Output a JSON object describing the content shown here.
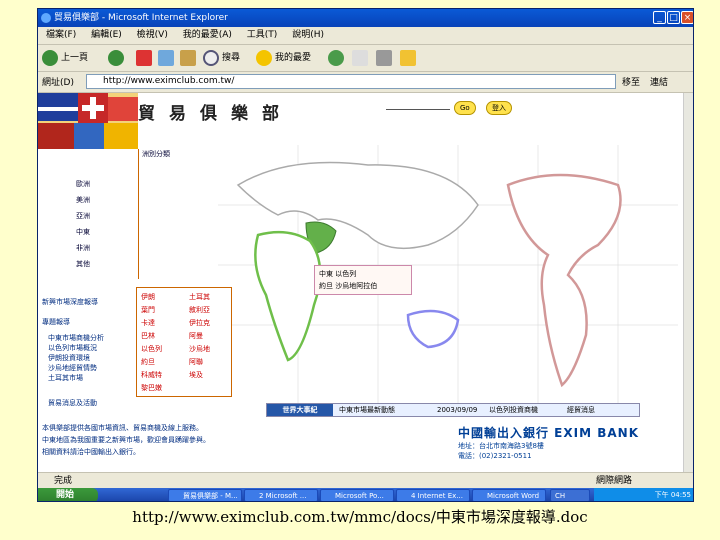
{
  "window": {
    "title": "貿易俱樂部 - Microsoft Internet Explorer"
  },
  "menu": [
    "檔案(F)",
    "編輯(E)",
    "檢視(V)",
    "我的最愛(A)",
    "工具(T)",
    "說明(H)"
  ],
  "toolbar": {
    "back_label": "上一頁",
    "search_label": "搜尋",
    "favorites_label": "我的最愛"
  },
  "address": {
    "label": "網址(D)",
    "value": "http://www.eximclub.com.tw/",
    "go_label": "移至",
    "links_label": "連結"
  },
  "site": {
    "title": "貿易俱樂部",
    "go_button": "Go",
    "login_button": "登入"
  },
  "categories": {
    "header": "洲別分類",
    "items": [
      "歐洲",
      "美洲",
      "亞洲",
      "中東",
      "非洲",
      "其他"
    ]
  },
  "country_list": {
    "col1": [
      "伊朗",
      "葉門",
      "卡達",
      "巴林",
      "以色列",
      "約旦",
      "科威特",
      "黎巴嫩"
    ],
    "col2": [
      "土耳其",
      "敘利亞",
      "伊拉克",
      "阿曼",
      "沙烏地",
      "阿聯",
      "埃及"
    ]
  },
  "left_section": {
    "heading": "新興市場深度報導",
    "subheading": "專題報導",
    "items": [
      "中東市場商機分析",
      "以色列市場概況",
      "伊朗投資環境",
      "沙烏地經貿情勢",
      "土耳其市場"
    ],
    "bottom_link": "貿易消息及活動"
  },
  "popup": {
    "line1": "中東 以色列",
    "line2": "約旦 沙烏地阿拉伯"
  },
  "news_bar": {
    "tag": "世界大事紀",
    "items": [
      "中東市場最新動態",
      "2003/09/09",
      "以色列投資商機",
      "經貿消息"
    ]
  },
  "bottom_text": [
    "本俱樂部提供各國市場資訊、貿易商機及線上服務。",
    "中東地區為我國重要之新興市場，歡迎會員踴躍參與。",
    "相關資料請洽中國輸出入銀行。"
  ],
  "bank": {
    "name": "中國輸出入銀行 EXIM BANK",
    "address": "地址：台北市南海路3號8樓",
    "phone": "電話：(02)2321-0511"
  },
  "status": {
    "left": "完成",
    "right": "網際網路"
  },
  "taskbar": {
    "start": "開始",
    "tasks": [
      "貿易俱樂部 - M...",
      "2 Microsoft ...",
      "Microsoft Po...",
      "4 Internet Ex...",
      "Microsoft Word",
      "CH"
    ],
    "time": "下午 04:55"
  },
  "caption": "http://www.eximclub.com.tw/mmc/docs/中東市場深度報導.doc"
}
